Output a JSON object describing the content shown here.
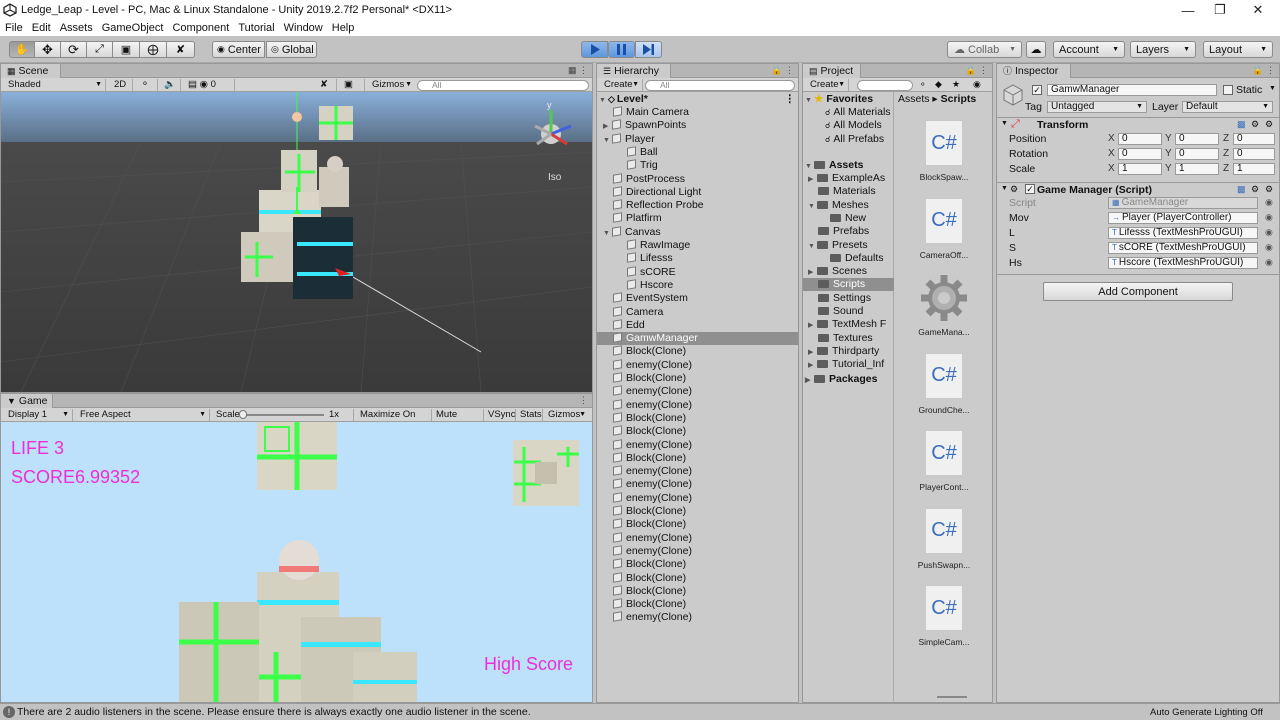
{
  "window": {
    "title": "Ledge_Leap - Level - PC, Mac & Linux Standalone - Unity 2019.2.7f2 Personal* <DX11>"
  },
  "menu": [
    "File",
    "Edit",
    "Assets",
    "GameObject",
    "Component",
    "Tutorial",
    "Window",
    "Help"
  ],
  "toolbar": {
    "center": "Center",
    "global": "Global",
    "collab": "Collab",
    "account": "Account",
    "layers": "Layers",
    "layout": "Layout"
  },
  "scene": {
    "tab": "Scene",
    "shaded": "Shaded",
    "mode2d": "2D",
    "fx_count": "0",
    "gizmos": "Gizmos",
    "search_placeholder": "All",
    "iso": "Iso",
    "axis_y": "y"
  },
  "game": {
    "tab": "Game",
    "display": "Display 1",
    "aspect": "Free Aspect",
    "scale_label": "Scale",
    "scale_value": "1x",
    "maximize": "Maximize On Play",
    "mute": "Mute Audio",
    "vsync": "VSync",
    "stats": "Stats",
    "gizmos": "Gizmos",
    "life_text": "LIFE 3",
    "score_text": "SCORE6.99352",
    "high_score_text": "High Score"
  },
  "hierarchy": {
    "tab": "Hierarchy",
    "create": "Create",
    "search_placeholder": "All",
    "scene_name": "Level*",
    "items": [
      {
        "label": "Main Camera",
        "depth": 1
      },
      {
        "label": "SpawnPoints",
        "depth": 1,
        "fold": "closed"
      },
      {
        "label": "Player",
        "depth": 1,
        "fold": "open"
      },
      {
        "label": "Ball",
        "depth": 2
      },
      {
        "label": "Trig",
        "depth": 2
      },
      {
        "label": "PostProcess",
        "depth": 1
      },
      {
        "label": "Directional Light",
        "depth": 1
      },
      {
        "label": "Reflection Probe",
        "depth": 1
      },
      {
        "label": "Platfirm",
        "depth": 1
      },
      {
        "label": "Canvas",
        "depth": 1,
        "fold": "open"
      },
      {
        "label": "RawImage",
        "depth": 2
      },
      {
        "label": "Lifesss",
        "depth": 2
      },
      {
        "label": "sCORE",
        "depth": 2
      },
      {
        "label": "Hscore",
        "depth": 2
      },
      {
        "label": "EventSystem",
        "depth": 1
      },
      {
        "label": "Camera",
        "depth": 1
      },
      {
        "label": "Edd",
        "depth": 1
      },
      {
        "label": "GamwManager",
        "depth": 1,
        "selected": true
      },
      {
        "label": "Block(Clone)",
        "depth": 1
      },
      {
        "label": "enemy(Clone)",
        "depth": 1
      },
      {
        "label": "Block(Clone)",
        "depth": 1
      },
      {
        "label": "enemy(Clone)",
        "depth": 1
      },
      {
        "label": "enemy(Clone)",
        "depth": 1
      },
      {
        "label": "Block(Clone)",
        "depth": 1
      },
      {
        "label": "Block(Clone)",
        "depth": 1
      },
      {
        "label": "enemy(Clone)",
        "depth": 1
      },
      {
        "label": "Block(Clone)",
        "depth": 1
      },
      {
        "label": "enemy(Clone)",
        "depth": 1
      },
      {
        "label": "enemy(Clone)",
        "depth": 1
      },
      {
        "label": "enemy(Clone)",
        "depth": 1
      },
      {
        "label": "Block(Clone)",
        "depth": 1
      },
      {
        "label": "Block(Clone)",
        "depth": 1
      },
      {
        "label": "enemy(Clone)",
        "depth": 1
      },
      {
        "label": "enemy(Clone)",
        "depth": 1
      },
      {
        "label": "Block(Clone)",
        "depth": 1
      },
      {
        "label": "Block(Clone)",
        "depth": 1
      },
      {
        "label": "Block(Clone)",
        "depth": 1
      },
      {
        "label": "Block(Clone)",
        "depth": 1
      },
      {
        "label": "enemy(Clone)",
        "depth": 1
      }
    ]
  },
  "project": {
    "tab": "Project",
    "create": "Create",
    "favorites": "Favorites",
    "fav_items": [
      "All Materials",
      "All Models",
      "All Prefabs"
    ],
    "assets_root": "Assets",
    "folders": [
      {
        "label": "ExampleAs",
        "depth": 1,
        "fold": "closed"
      },
      {
        "label": "Materials",
        "depth": 1
      },
      {
        "label": "Meshes",
        "depth": 1,
        "fold": "open"
      },
      {
        "label": "New",
        "depth": 2
      },
      {
        "label": "Prefabs",
        "depth": 1
      },
      {
        "label": "Presets",
        "depth": 1,
        "fold": "open"
      },
      {
        "label": "Defaults",
        "depth": 2
      },
      {
        "label": "Scenes",
        "depth": 1,
        "fold": "closed"
      },
      {
        "label": "Scripts",
        "depth": 1,
        "selected": true
      },
      {
        "label": "Settings",
        "depth": 1
      },
      {
        "label": "Sound",
        "depth": 1
      },
      {
        "label": "TextMesh F",
        "depth": 1,
        "fold": "closed"
      },
      {
        "label": "Textures",
        "depth": 1
      },
      {
        "label": "Thirdparty",
        "depth": 1,
        "fold": "closed"
      },
      {
        "label": "Tutorial_Inf",
        "depth": 1,
        "fold": "closed"
      }
    ],
    "packages": "Packages",
    "breadcrumb": [
      "Assets",
      "Scripts"
    ],
    "files": [
      {
        "label": "BlockSpaw...",
        "kind": "cs"
      },
      {
        "label": "CameraOff...",
        "kind": "cs"
      },
      {
        "label": "GameMana...",
        "kind": "gear"
      },
      {
        "label": "GroundChe...",
        "kind": "cs"
      },
      {
        "label": "PlayerCont...",
        "kind": "cs"
      },
      {
        "label": "PushSwapn...",
        "kind": "cs"
      },
      {
        "label": "SimpleCam...",
        "kind": "cs"
      }
    ]
  },
  "inspector": {
    "tab": "Inspector",
    "object_name": "GamwManager",
    "static": "Static",
    "tag_label": "Tag",
    "tag_value": "Untagged",
    "layer_label": "Layer",
    "layer_value": "Default",
    "transform": {
      "title": "Transform",
      "rows": [
        {
          "label": "Position",
          "x": "0",
          "y": "0",
          "z": "0"
        },
        {
          "label": "Rotation",
          "x": "0",
          "y": "0",
          "z": "0"
        },
        {
          "label": "Scale",
          "x": "1",
          "y": "1",
          "z": "1"
        }
      ]
    },
    "component": {
      "title": "Game Manager (Script)",
      "rows": [
        {
          "label": "Script",
          "value": "GameManager",
          "disabled": true
        },
        {
          "label": "Mov",
          "value": "Player (PlayerController)"
        },
        {
          "label": "L",
          "value": "Lifesss (TextMeshProUGUI)"
        },
        {
          "label": "S",
          "value": "sCORE (TextMeshProUGUI)"
        },
        {
          "label": "Hs",
          "value": "Hscore (TextMeshProUGUI)"
        }
      ]
    },
    "add_component": "Add Component"
  },
  "status": {
    "message": "There are 2 audio listeners in the scene. Please ensure there is always exactly one audio listener in the scene.",
    "right": "Auto Generate Lighting Off"
  },
  "colors": {
    "accent": "#3d7fdc",
    "selection": "#8f8f8f",
    "game_text": "#ec2fd6",
    "game_sky": "#bde0fb",
    "scene_bg": "#393939",
    "neon": "#3cff4a",
    "cyan": "#39e8ff"
  }
}
